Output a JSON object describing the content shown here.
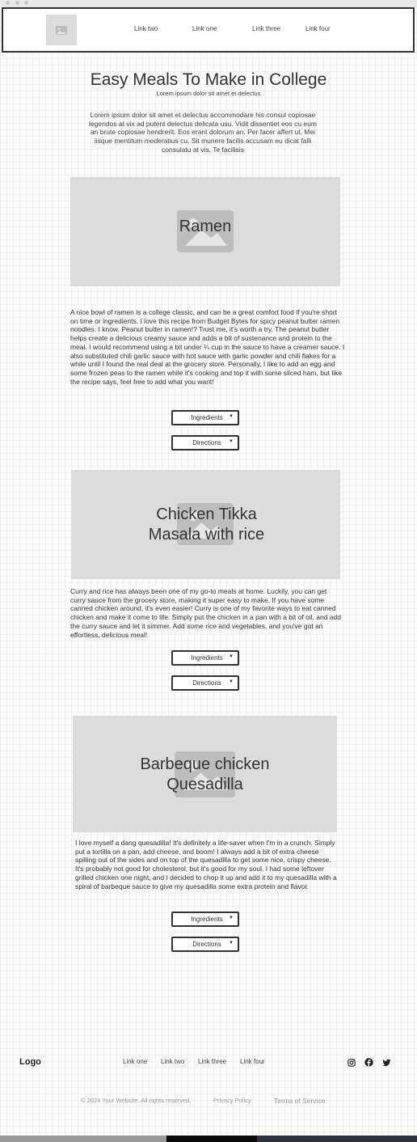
{
  "header": {
    "nav": [
      "Link two",
      "Link one",
      "Link three",
      "Link four"
    ]
  },
  "hero": {
    "title": "Easy Meals To Make in College",
    "subtitle": "Lorem ipsum dolor sit amet et delectus",
    "intro": "Lorem ipsum dolor sit amet et delectus accommodare his consul copiosae legendos at vix ad putent delectus delicata usu. Vidit dissentiet eos cu eum an brute copiosae hendrerit. Eos erant dolorum an. Per facer affert ut. Mei iisque mentitum moderatius cu. Sit munere facilis accusam eu dicat falli consulatu at vis. Te facilisis"
  },
  "recipes": [
    {
      "image_label": "Ramen",
      "description": "A nice bowl of ramen is a college classic, and can be a great comfort food if you're short on time or ingredients. I love this recipe from Budget Bytes for spicy peanut butter ramen noodles. I know. Peanut butter in ramen!? Trust me, it's worth a try. The peanut butter helps create a delicious creamy sauce and adds a bit of sustenance and protein to the meal. I would recommend using a bit under ¼ cup in the sauce to have a creamer sauce. I also substituted chili garlic sauce with hot sauce with garlic powder and chili flakes for a while until I found the real deal at the grocery store. Personally, I like to add an egg and some frozen peas to the ramen while it's cooking and top it with some sliced ham, but like the recipe says, feel free to add what you want!",
      "ingredients_label": "Ingredients",
      "directions_label": "Directions"
    },
    {
      "image_label": "Chicken Tikka Masala with rice",
      "description": "Curry and rice has always been one of my go-to meals at home. Luckily, you can get curry sauce from the grocery store, making it super easy to make. If you have some canned chicken around, it's even easier! Curry is one of my favorite ways to eat canned chicken and make it come to life. Simply put the chicken in a pan with a bit of oil, and add the curry sauce and let it simmer. Add some rice and vegetables, and you've got an effortless, delicious meal!",
      "ingredients_label": "Ingredients",
      "directions_label": "Directions"
    },
    {
      "image_label": "Barbeque chicken Quesadilla",
      "description": "I love myself a dang quesadilla! It's definitely a life-saver when I'm in a crunch. Simply put a tortilla on a pan, add cheese, and boom! I always add a bit of extra cheese spilling out of the sides and on top of the quesadilla to get some nice, crispy cheese. It's probably not good for cholesterol, but it's good for my soul. I had some leftover grilled chicken one night, and I decided to chop it up and add it to my quesadilla with a spiral of barbeque sauce to give my quesadilla some extra protein and flavor.",
      "ingredients_label": "Ingredients",
      "directions_label": "Directions"
    }
  ],
  "footer": {
    "logo": "Logo",
    "nav": [
      "Link one",
      "Link two",
      "Link three",
      "Link four"
    ],
    "social_icons": [
      "instagram-icon",
      "facebook-icon",
      "twitter-icon"
    ],
    "copyright": "© 2024 Your Website. All rights reserved.",
    "privacy": "Privacy Policy",
    "terms": "Terms of Service"
  },
  "colors": {
    "placeholder": "#dcdcdc",
    "border": "#333333",
    "text": "#333333"
  }
}
